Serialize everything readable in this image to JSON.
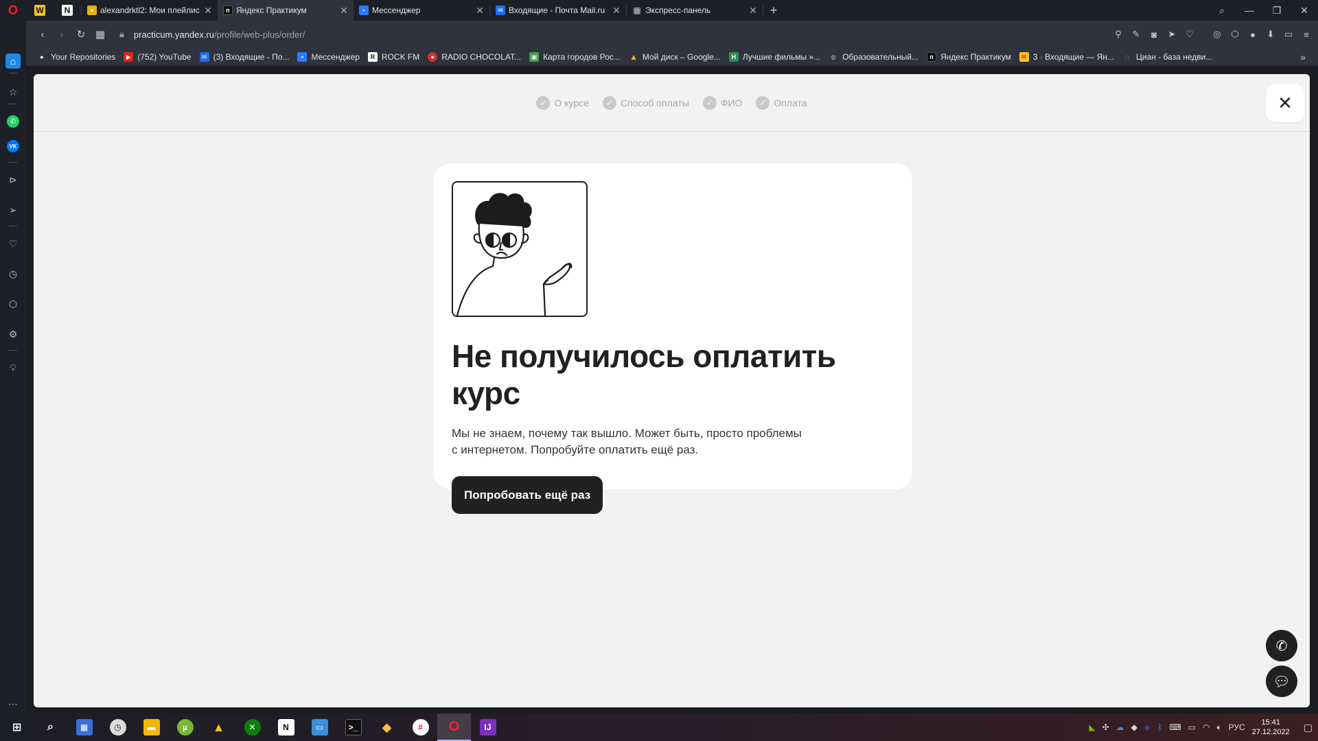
{
  "tabs": [
    {
      "title": "alexandrktl2: Мои плейлис",
      "favicon": "last-fm-icon",
      "color": "#e8b100"
    },
    {
      "title": "Яндекс Практикум",
      "favicon": "practicum-icon",
      "color": "#111111",
      "active": true
    },
    {
      "title": "Мессенджер",
      "favicon": "messenger-icon",
      "color": "#2a7bff"
    },
    {
      "title": "Входящие - Почта Mail.ru",
      "favicon": "mail-icon",
      "color": "#1f6feb"
    },
    {
      "title": "Экспресс-панель",
      "favicon": "speed-dial-icon",
      "color": "#888888"
    }
  ],
  "address": {
    "host": "practicum.yandex.ru",
    "path": "/profile/web-plus/order/"
  },
  "bookmarks": [
    {
      "label": "Your Repositories",
      "icon": "github-icon",
      "color": "#333333"
    },
    {
      "label": "(752) YouTube",
      "icon": "youtube-icon",
      "color": "#e62117"
    },
    {
      "label": "(3) Входящие - По...",
      "icon": "mail-icon",
      "color": "#1f6feb"
    },
    {
      "label": "Мессенджер",
      "icon": "messenger-icon",
      "color": "#2a7bff"
    },
    {
      "label": "ROCK FM",
      "icon": "rockfm-icon",
      "color": "#222222"
    },
    {
      "label": "RADIO CHOCOLAT...",
      "icon": "radio-icon",
      "color": "#d0302f"
    },
    {
      "label": "Карта городов Рос...",
      "icon": "map-icon",
      "color": "#3fa34d"
    },
    {
      "label": "Мой диск – Google...",
      "icon": "google-drive-icon",
      "color": "#f4b400"
    },
    {
      "label": "Лучшие фильмы »...",
      "icon": "film-icon",
      "color": "#2e8b57"
    },
    {
      "label": "Образовательный...",
      "icon": "edu-icon",
      "color": "#555555"
    },
    {
      "label": "Яндекс Практикум",
      "icon": "practicum-icon",
      "color": "#111111"
    },
    {
      "label": "3 · Входящие — Ян...",
      "icon": "yandex-mail-icon",
      "color": "#f6c21c"
    },
    {
      "label": "Циан - база недви...",
      "icon": "cian-icon",
      "color": "#2b6fff"
    }
  ],
  "steps": [
    {
      "label": "О курсе"
    },
    {
      "label": "Способ оплаты"
    },
    {
      "label": "ФИО"
    },
    {
      "label": "Оплата"
    }
  ],
  "error": {
    "title": "Не получилось оплатить курс",
    "description_line1": "Мы не знаем, почему так вышло. Может быть, просто проблемы",
    "description_line2": "с интернетом. Попробуйте оплатить ещё раз.",
    "retry_label": "Попробовать ещё раз"
  },
  "tray": {
    "language": "РУС",
    "time": "15:41",
    "date": "27.12.2022"
  }
}
